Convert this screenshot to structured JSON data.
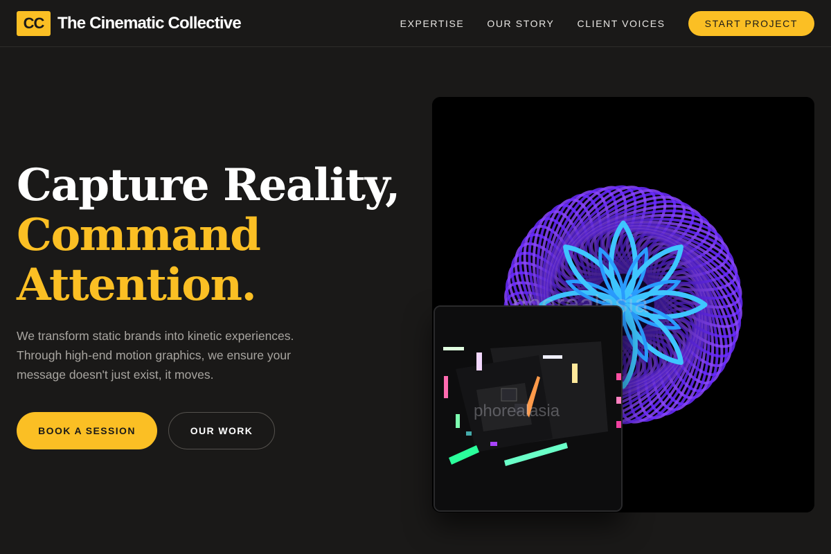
{
  "brand": {
    "badge": "CC",
    "name": "The Cinematic Collective",
    "accent": "#fbbf24",
    "background": "#1a1918"
  },
  "nav": {
    "links": [
      "EXPERTISE",
      "OUR STORY",
      "CLIENT VOICES"
    ],
    "cta": "START PROJECT"
  },
  "hero": {
    "title_line1": "Capture Reality,",
    "title_line2": "Command",
    "title_line3": "Attention.",
    "subtitle": "We transform static brands into kinetic experiences. Through high-end motion graphics, we ensure your message doesn't just exist, it moves.",
    "primary_button": "BOOK A SESSION",
    "secondary_button": "OUR WORK"
  },
  "media": {
    "main_image": "neon-torus-lotus-render",
    "main_watermark": "phorealasia",
    "inset_image": "neon-studio-equipment-render",
    "inset_watermark": "phorealasia"
  }
}
